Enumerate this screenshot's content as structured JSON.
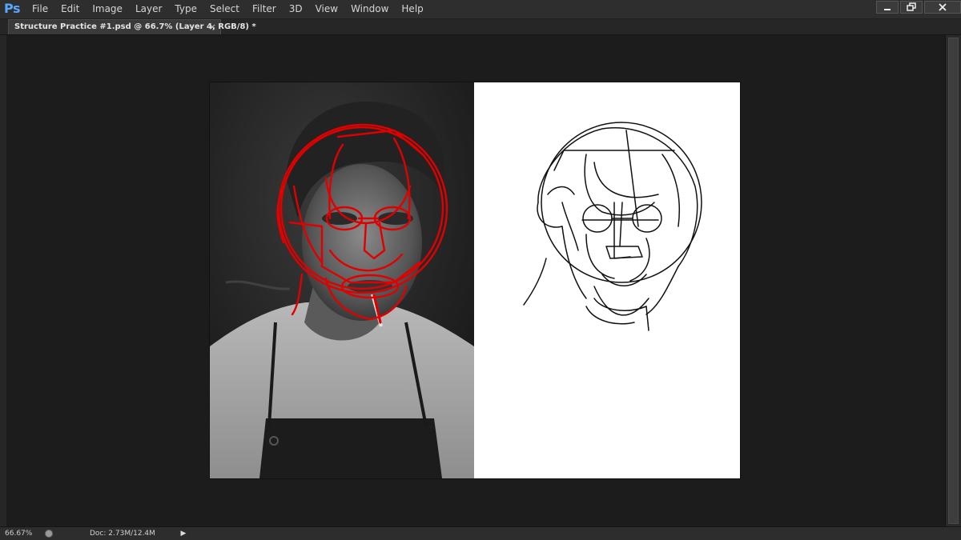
{
  "app": {
    "logo_text": "Ps",
    "menu": [
      "File",
      "Edit",
      "Image",
      "Layer",
      "Type",
      "Select",
      "Filter",
      "3D",
      "View",
      "Window",
      "Help"
    ],
    "window_controls": {
      "minimize_icon": "minimize-icon",
      "restore_icon": "restore-icon",
      "close_icon": "close-icon"
    }
  },
  "document": {
    "tab_title": "Structure Practice #1.psd @ 66.7% (Layer 4, RGB/8) *",
    "tab_close": "×"
  },
  "canvas": {
    "left_panel": "grayscale-photo-with-red-structure-lines",
    "right_panel": "black-line-structure-sketch",
    "colors": {
      "structure_lines": "#e00000",
      "sketch_lines": "#111111",
      "paper": "#ffffff"
    }
  },
  "status": {
    "zoom": "66.67%",
    "doc_info": "Doc: 2.73M/12.4M",
    "arrow": "▶"
  },
  "colors": {
    "ps_logo": "#5aa6ff",
    "workspace": "#1c1c1c",
    "menubar": "#2e2e2e"
  }
}
